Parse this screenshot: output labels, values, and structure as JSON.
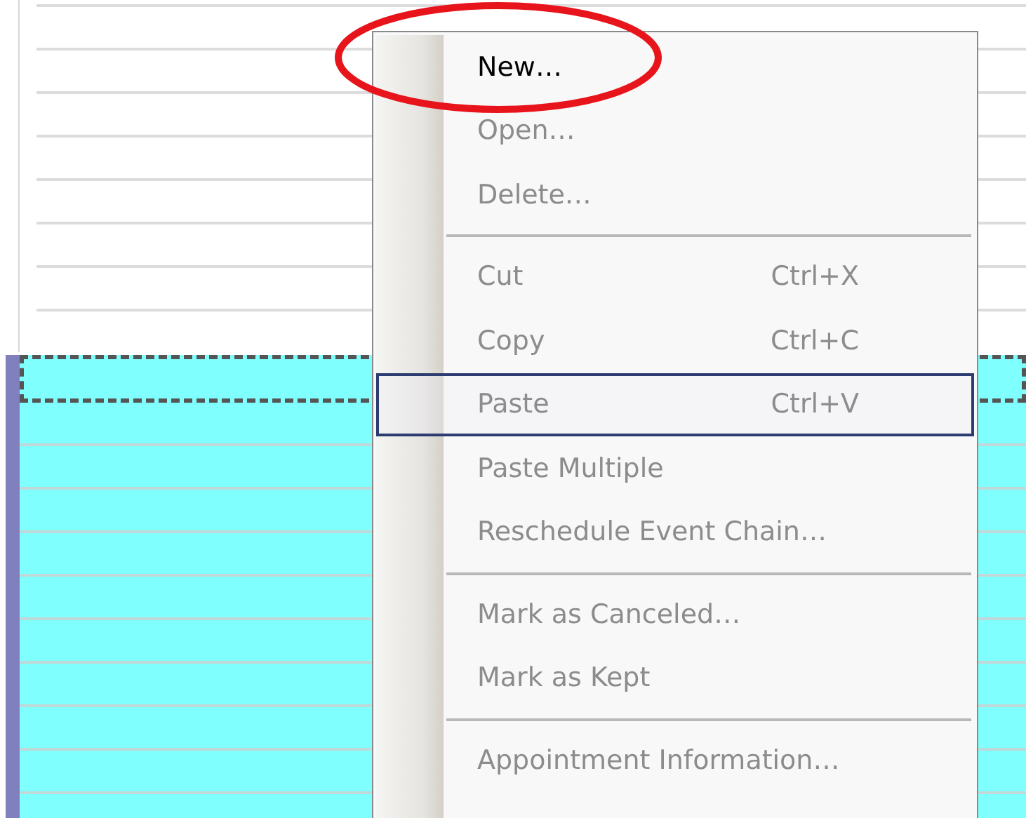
{
  "calendar": {
    "appointment": {
      "selected": true
    }
  },
  "context_menu": {
    "items": [
      {
        "kind": "item",
        "label": "New…",
        "disabled": false,
        "selected": false
      },
      {
        "kind": "item",
        "label": "Open…",
        "disabled": true,
        "selected": false
      },
      {
        "kind": "item",
        "label": "Delete…",
        "disabled": true,
        "selected": false
      },
      {
        "kind": "separator"
      },
      {
        "kind": "item",
        "label": "Cut",
        "shortcut": "Ctrl+X",
        "disabled": true,
        "selected": false
      },
      {
        "kind": "item",
        "label": "Copy",
        "shortcut": "Ctrl+C",
        "disabled": true,
        "selected": false
      },
      {
        "kind": "item",
        "label": "Paste",
        "shortcut": "Ctrl+V",
        "disabled": true,
        "selected": true
      },
      {
        "kind": "item",
        "label": "Paste Multiple",
        "disabled": true,
        "selected": false
      },
      {
        "kind": "item",
        "label": "Reschedule Event Chain…",
        "disabled": true,
        "selected": false
      },
      {
        "kind": "separator"
      },
      {
        "kind": "item",
        "label": "Mark as Canceled…",
        "disabled": true,
        "selected": false
      },
      {
        "kind": "item",
        "label": "Mark as Kept",
        "disabled": true,
        "selected": false
      },
      {
        "kind": "separator"
      },
      {
        "kind": "item",
        "label": "Appointment Information…",
        "disabled": true,
        "selected": false
      }
    ]
  },
  "annotation": {
    "kind": "ellipse",
    "color": "#e8141b"
  }
}
